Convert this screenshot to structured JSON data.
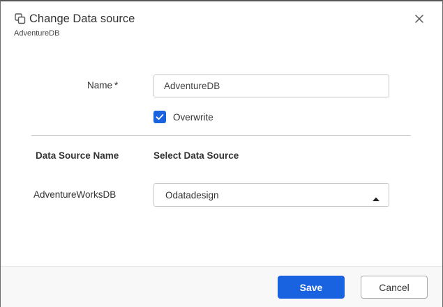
{
  "dialog": {
    "title": "Change Data source",
    "subtitle": "AdventureDB",
    "title_icon": "copy-icon",
    "close_icon": "close-icon"
  },
  "form": {
    "name_label": "Name",
    "required_marker": "*",
    "name_value": "AdventureDB",
    "overwrite_label": "Overwrite",
    "overwrite_checked": true
  },
  "mapping": {
    "col_left": "Data Source Name",
    "col_right": "Select Data Source",
    "rows": [
      {
        "source_name": "AdventureWorksDB",
        "selected": "Odatadesign"
      }
    ]
  },
  "footer": {
    "save_label": "Save",
    "cancel_label": "Cancel"
  },
  "colors": {
    "accent": "#1a63e0",
    "border": "#c8c8c8",
    "footer_bg": "#f8f8f8"
  }
}
